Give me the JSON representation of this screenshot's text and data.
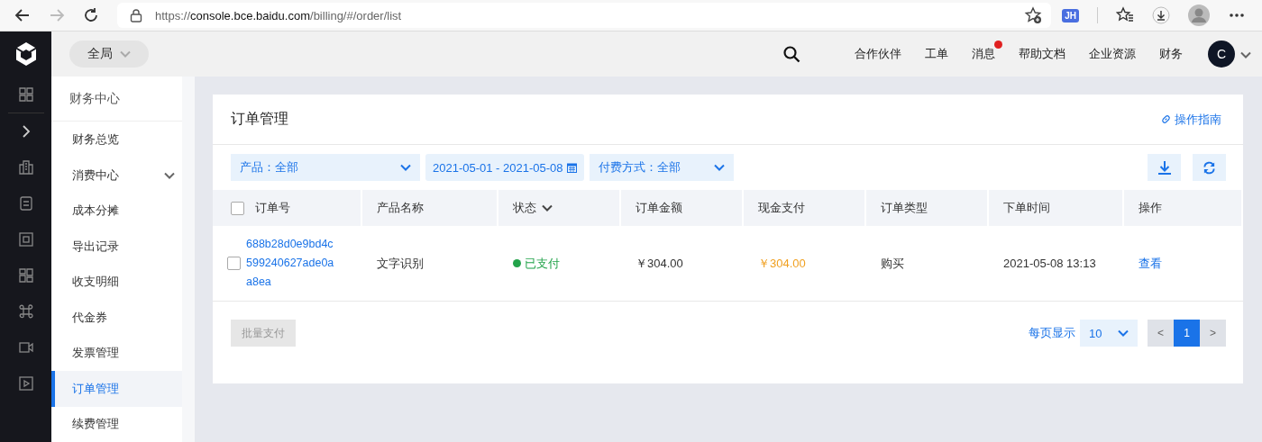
{
  "browser": {
    "url": "https://**console.bce.baidu.com**/billing/#/order/list",
    "extension_badge": "JH"
  },
  "header": {
    "scope": "全局",
    "nav": [
      {
        "label": "合作伙伴",
        "badge": false
      },
      {
        "label": "工单",
        "badge": false
      },
      {
        "label": "消息",
        "badge": true
      },
      {
        "label": "帮助文档",
        "badge": false
      },
      {
        "label": "企业资源",
        "badge": false
      },
      {
        "label": "财务",
        "badge": false
      }
    ],
    "avatar": "C"
  },
  "sidebar": {
    "title": "财务中心",
    "items": [
      {
        "label": "财务总览",
        "kind": "link",
        "selected": false
      },
      {
        "label": "消费中心",
        "kind": "group",
        "selected": false
      },
      {
        "label": "成本分摊",
        "kind": "link",
        "selected": false
      },
      {
        "label": "导出记录",
        "kind": "link",
        "selected": false
      },
      {
        "label": "收支明细",
        "kind": "link",
        "selected": false
      },
      {
        "label": "代金券",
        "kind": "link",
        "selected": false
      },
      {
        "label": "发票管理",
        "kind": "link",
        "selected": false
      },
      {
        "label": "订单管理",
        "kind": "link",
        "selected": true
      },
      {
        "label": "续费管理",
        "kind": "link",
        "selected": false
      }
    ]
  },
  "page": {
    "title": "订单管理",
    "guide_link": "操作指南"
  },
  "filters": [
    {
      "label": "产品：全部",
      "kind": "select"
    },
    {
      "label": "2021-05-01 - 2021-05-08",
      "kind": "date"
    },
    {
      "label": "付费方式：全部",
      "kind": "select"
    }
  ],
  "table": {
    "columns": [
      {
        "label": "订单号",
        "sortable": false
      },
      {
        "label": "产品名称",
        "sortable": false
      },
      {
        "label": "状态",
        "sortable": true
      },
      {
        "label": "订单金额",
        "sortable": false
      },
      {
        "label": "现金支付",
        "sortable": false
      },
      {
        "label": "订单类型",
        "sortable": false
      },
      {
        "label": "下单时间",
        "sortable": false
      },
      {
        "label": "操作",
        "sortable": false
      }
    ],
    "header_checked": false,
    "rows": [
      {
        "checked": false,
        "order_id": "688b28d0e9bd4c599240627ade0aa8ea",
        "product": "文字识别",
        "status": "已支付",
        "amount": "￥304.00",
        "cash": "￥304.00",
        "type": "购买",
        "time": "2021-05-08 13:13",
        "action": "查看"
      }
    ]
  },
  "footer": {
    "batch_button": {
      "label": "批量支付",
      "disabled": true
    },
    "page_size_label": "每页显示",
    "page_size": "10",
    "prev": "<",
    "pages": [
      {
        "label": "1",
        "selected": true
      }
    ],
    "next": ">"
  }
}
